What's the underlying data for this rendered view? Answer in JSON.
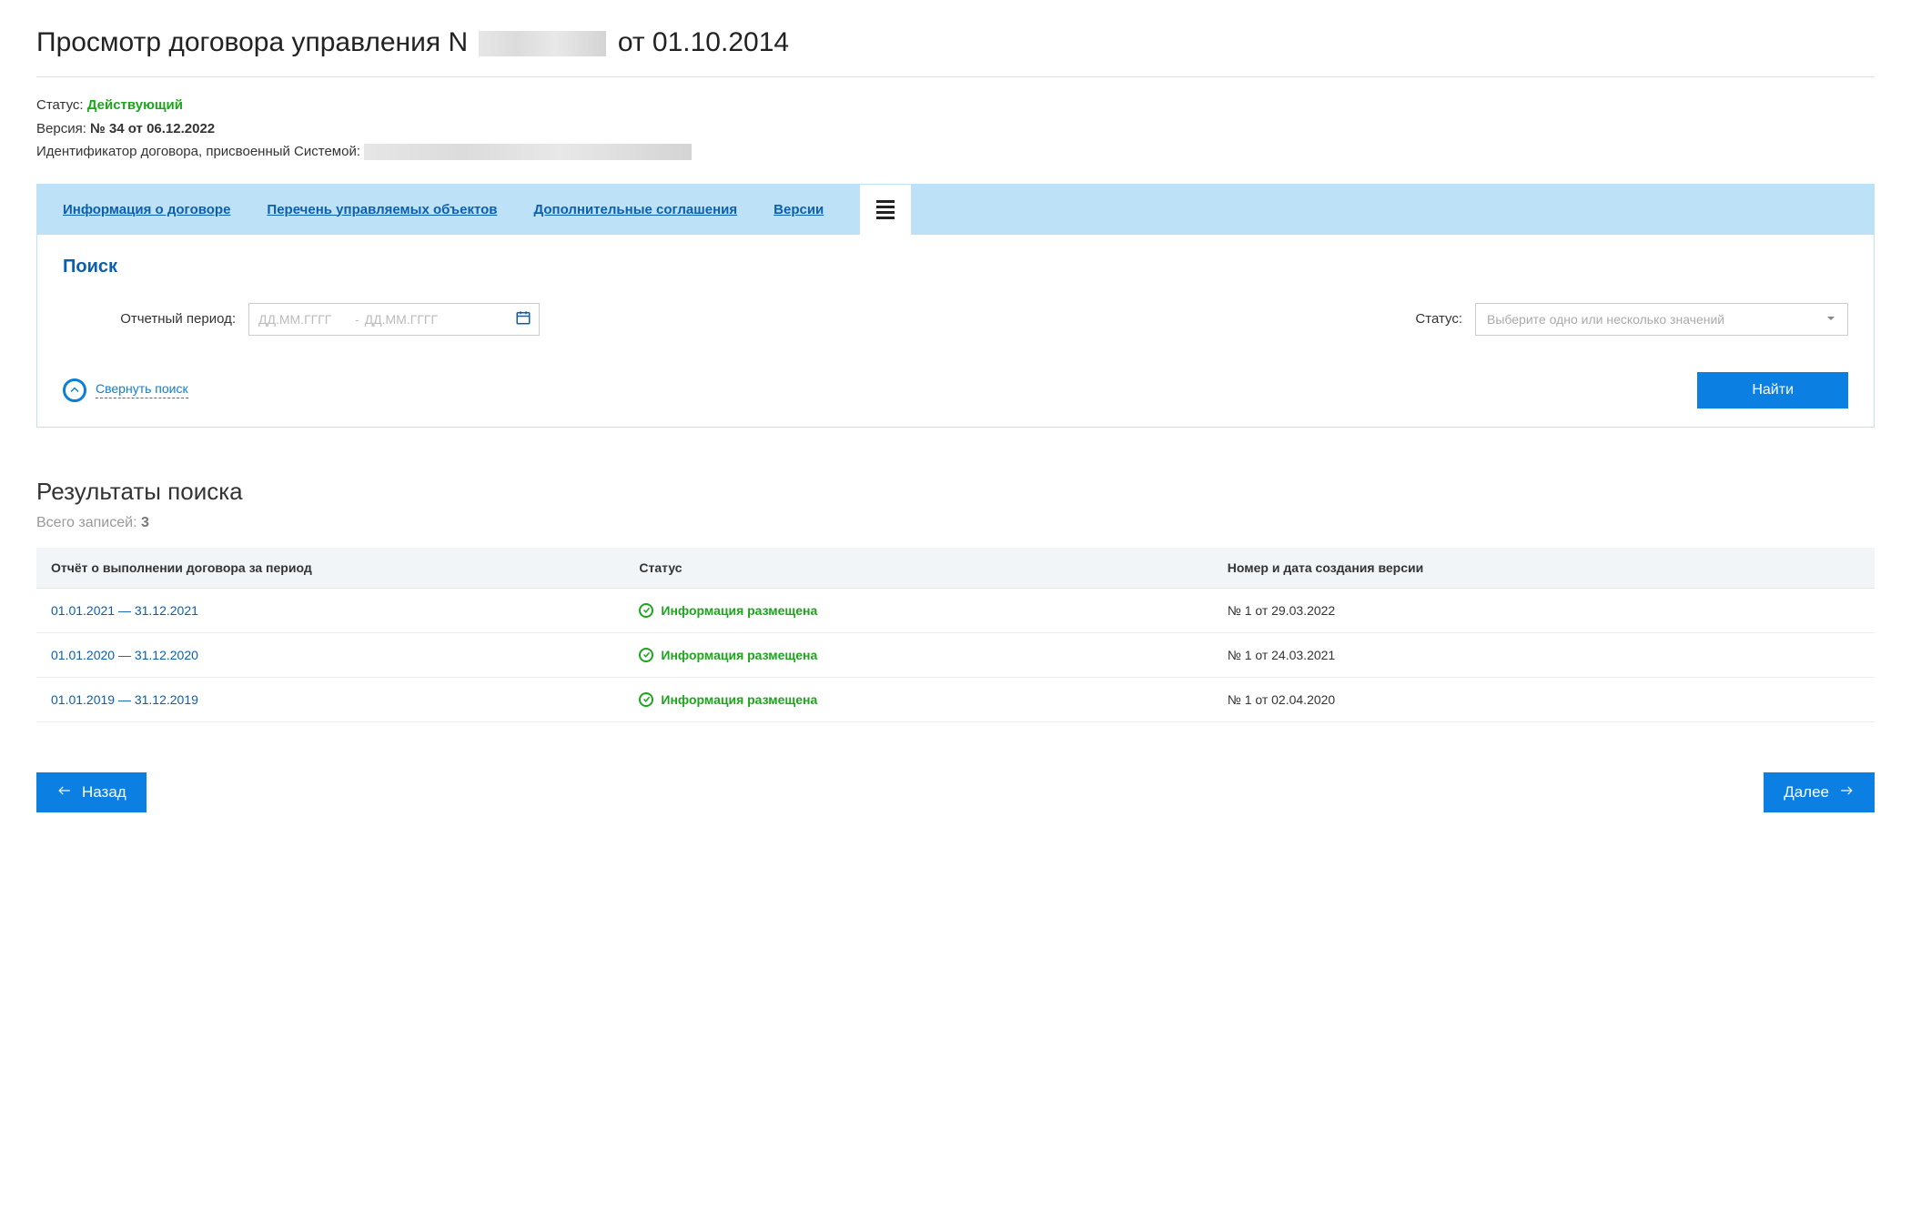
{
  "title_prefix": "Просмотр договора управления N",
  "title_suffix": "от 01.10.2014",
  "meta": {
    "status_label": "Статус:",
    "status_value": "Действующий",
    "version_label": "Версия:",
    "version_value": "№ 34 от 06.12.2022",
    "id_label": "Идентификатор договора, присвоенный Системой:"
  },
  "tabs": {
    "info": "Информация о договоре",
    "objects": "Перечень управляемых объектов",
    "agreements": "Дополнительные соглашения",
    "versions": "Версии"
  },
  "search": {
    "title": "Поиск",
    "period_label": "Отчетный период:",
    "date_placeholder": "ДД.ММ.ГГГГ",
    "date_sep": "-",
    "status_label": "Статус:",
    "status_placeholder": "Выберите одно или несколько значений",
    "collapse": "Свернуть поиск",
    "find": "Найти"
  },
  "results": {
    "title": "Результаты поиска",
    "total_label": "Всего записей:",
    "total": "3",
    "columns": {
      "period": "Отчёт о выполнении договора за период",
      "status": "Статус",
      "version": "Номер и дата создания версии"
    },
    "rows": [
      {
        "period": "01.01.2021 — 31.12.2021",
        "status": "Информация размещена",
        "version": "№ 1 от 29.03.2022"
      },
      {
        "period": "01.01.2020 — 31.12.2020",
        "status": "Информация размещена",
        "version": "№ 1 от 24.03.2021"
      },
      {
        "period": "01.01.2019 — 31.12.2019",
        "status": "Информация размещена",
        "version": "№ 1 от 02.04.2020"
      }
    ]
  },
  "nav": {
    "back": "Назад",
    "next": "Далее"
  }
}
